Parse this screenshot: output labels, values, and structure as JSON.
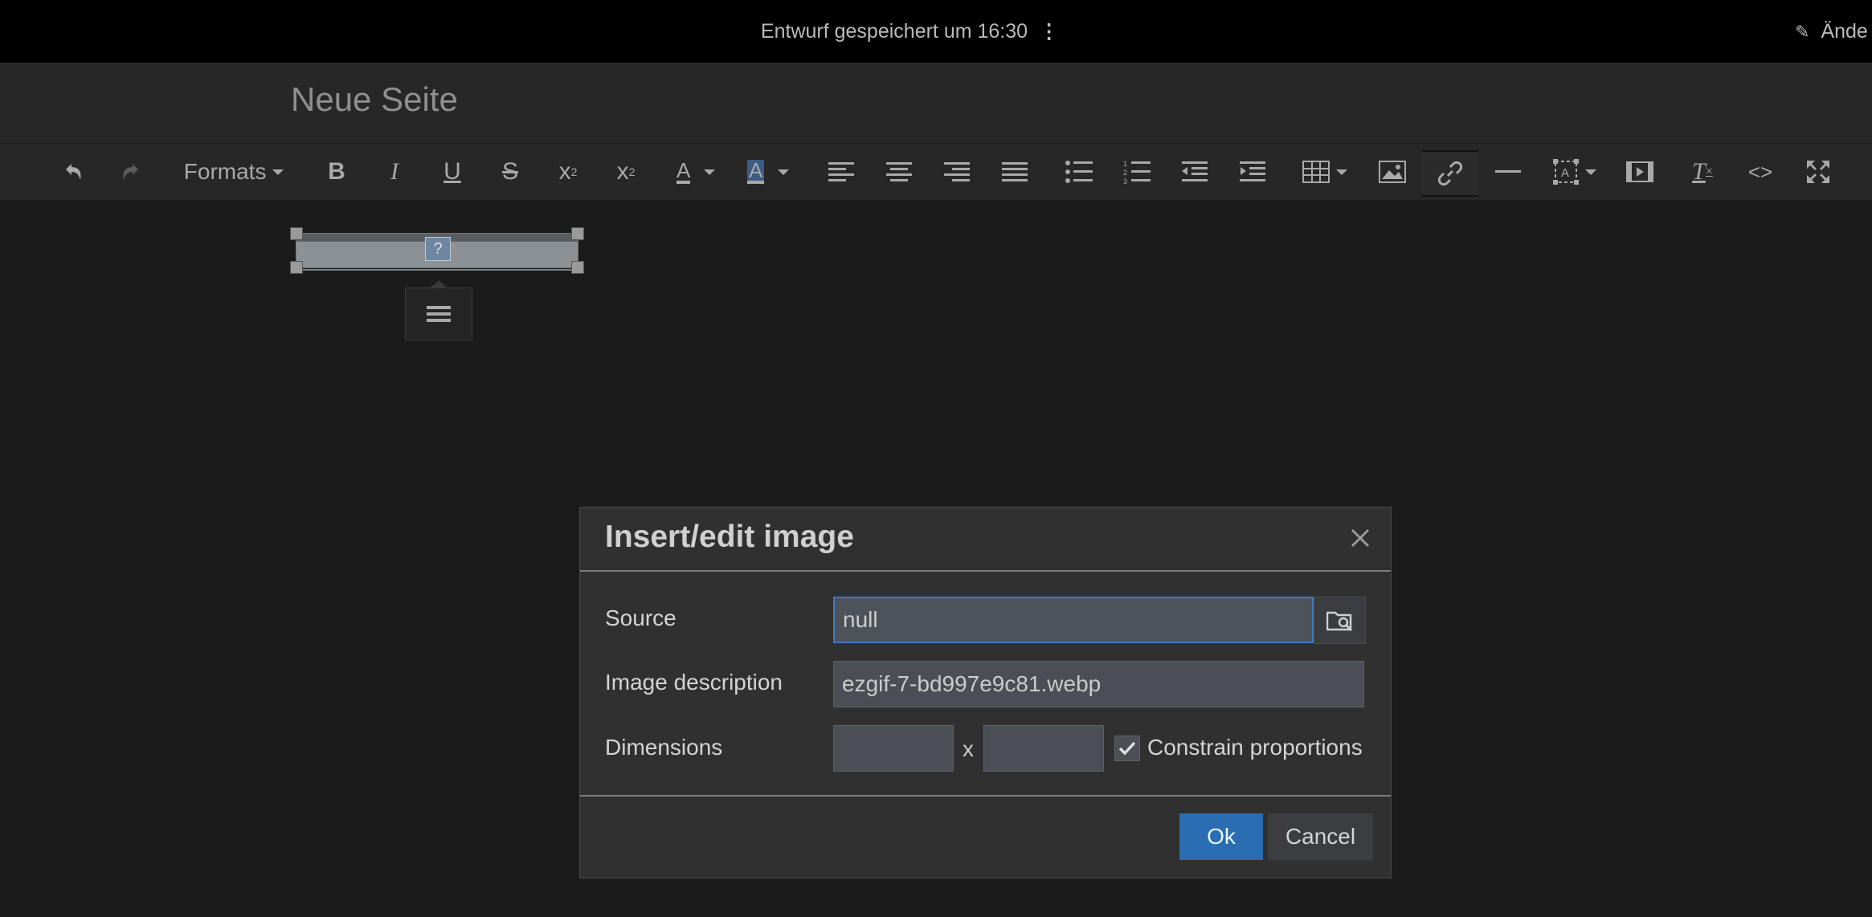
{
  "topbar": {
    "status_text": "Entwurf gespeichert um 16:30",
    "kebab_icon": "vertical-ellipsis-icon",
    "edit_label": "Ände"
  },
  "page": {
    "title": "Neue Seite"
  },
  "toolbar": {
    "formats_label": "Formats",
    "icons": [
      "undo-icon",
      "redo-icon",
      "bold-icon",
      "italic-icon",
      "underline-icon",
      "strikethrough-icon",
      "superscript-icon",
      "subscript-icon",
      "text-color-icon",
      "background-color-icon",
      "align-left-icon",
      "align-center-icon",
      "align-right-icon",
      "align-justify-icon",
      "bullet-list-icon",
      "numbered-list-icon",
      "outdent-icon",
      "indent-icon",
      "table-icon",
      "image-icon",
      "link-icon",
      "horizontal-rule-icon",
      "template-icon",
      "media-icon",
      "clear-formatting-icon",
      "source-code-icon",
      "fullscreen-icon"
    ]
  },
  "image_placeholder": {
    "icon_text": "?"
  },
  "dialog": {
    "title": "Insert/edit image",
    "source_label": "Source",
    "source_value": "null",
    "description_label": "Image description",
    "description_value": "ezgif-7-bd997e9c81.webp",
    "dimensions_label": "Dimensions",
    "width_value": "",
    "height_value": "",
    "dimension_separator": "x",
    "constrain_label": "Constrain proportions",
    "constrain_checked": true,
    "ok_label": "Ok",
    "cancel_label": "Cancel"
  },
  "colors": {
    "accent": "#2a6db3",
    "focus_border": "#3f7ab8",
    "background": "#1b1b1b",
    "toolbar": "#272727"
  }
}
